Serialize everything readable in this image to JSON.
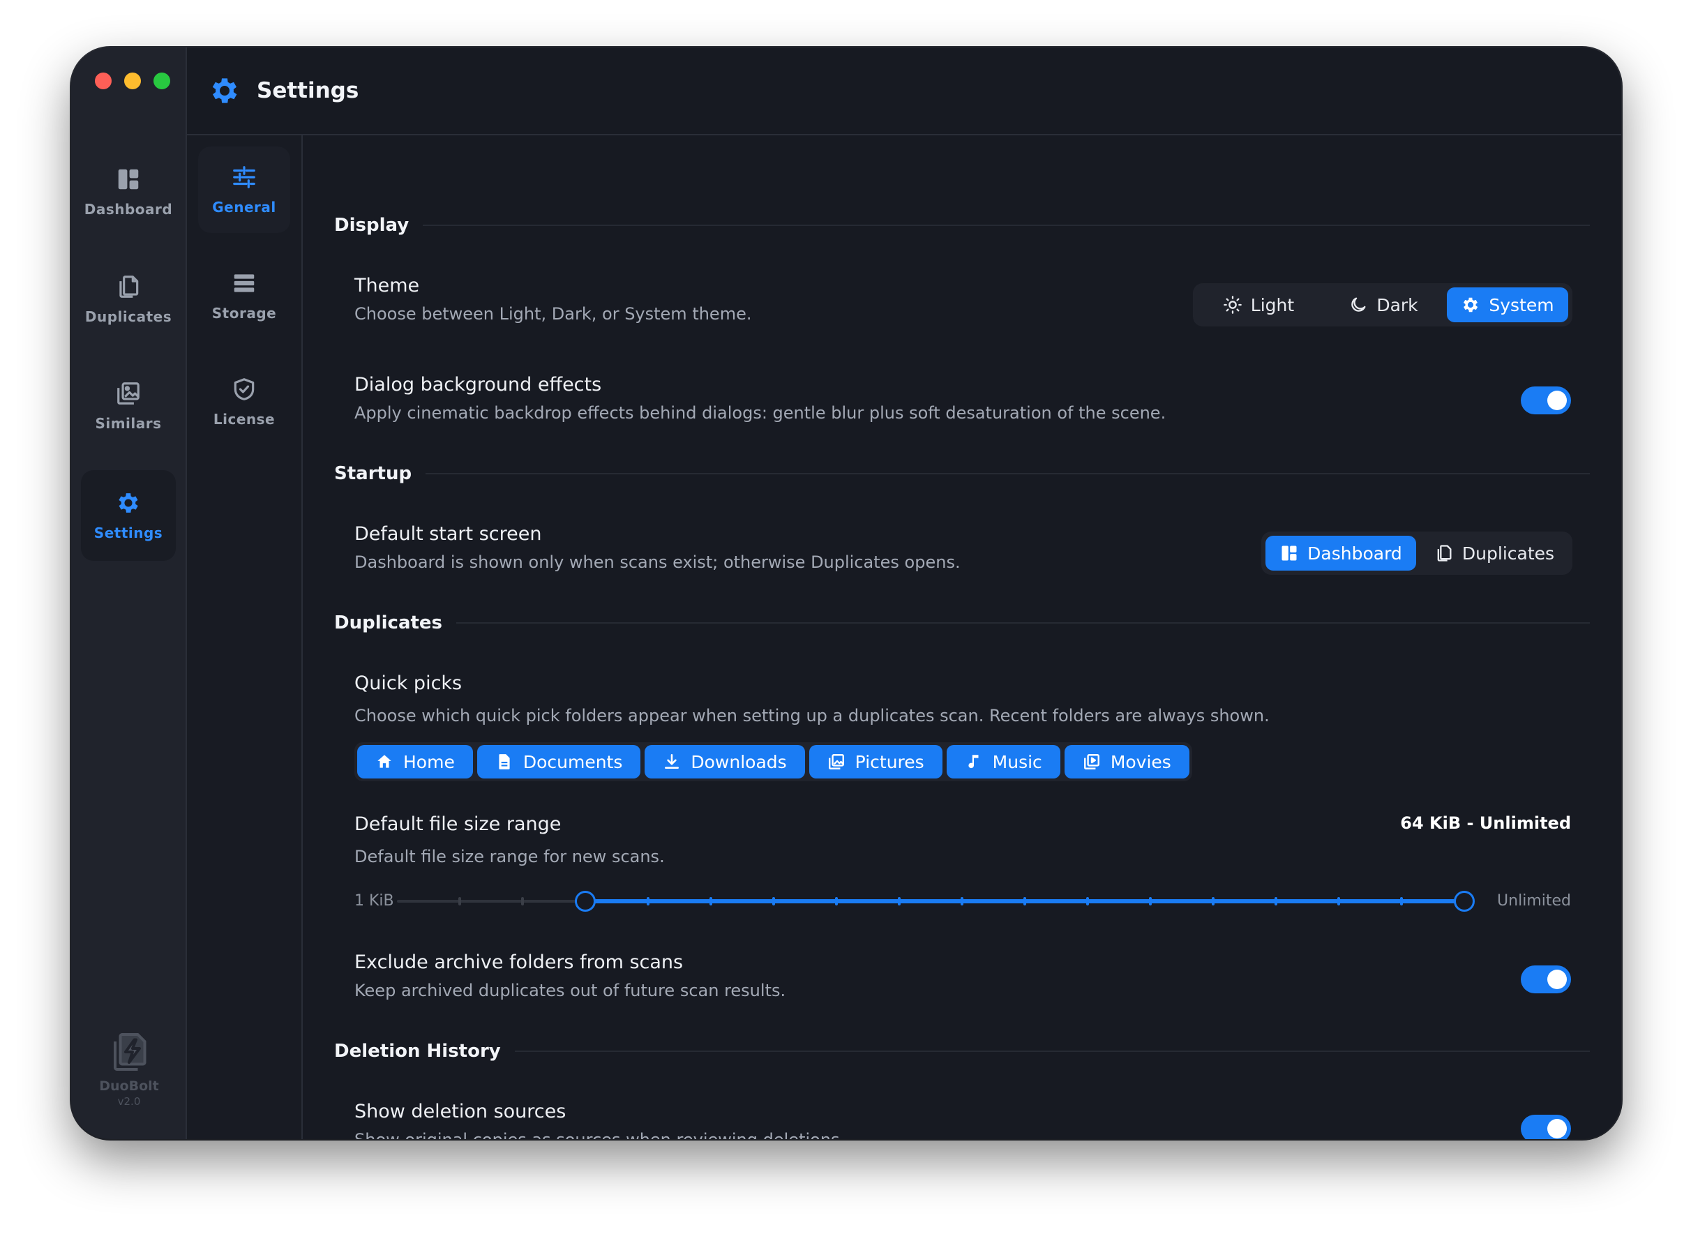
{
  "window": {
    "title": "Settings"
  },
  "main_nav": {
    "items": [
      {
        "label": "Dashboard",
        "icon": "dashboard-icon",
        "active": false
      },
      {
        "label": "Duplicates",
        "icon": "duplicates-icon",
        "active": false
      },
      {
        "label": "Similars",
        "icon": "similars-icon",
        "active": false
      },
      {
        "label": "Settings",
        "icon": "gear-icon",
        "active": true
      }
    ],
    "brand": {
      "name": "DuoBolt",
      "version": "v2.0"
    }
  },
  "sub_nav": {
    "items": [
      {
        "label": "General",
        "icon": "sliders-icon",
        "active": true
      },
      {
        "label": "Storage",
        "icon": "storage-icon",
        "active": false
      },
      {
        "label": "License",
        "icon": "shield-check-icon",
        "active": false
      }
    ]
  },
  "sections": {
    "display": {
      "label": "Display",
      "theme": {
        "title": "Theme",
        "description": "Choose between Light, Dark, or System theme.",
        "options": [
          "Light",
          "Dark",
          "System"
        ],
        "selected": "System"
      },
      "dialog_effects": {
        "title": "Dialog background effects",
        "description": "Apply cinematic backdrop effects behind dialogs: gentle blur plus soft desaturation of the scene.",
        "enabled": true
      }
    },
    "startup": {
      "label": "Startup",
      "default_screen": {
        "title": "Default start screen",
        "description": "Dashboard is shown only when scans exist; otherwise Duplicates opens.",
        "options": [
          "Dashboard",
          "Duplicates"
        ],
        "selected": "Dashboard"
      }
    },
    "duplicates": {
      "label": "Duplicates",
      "quick_picks": {
        "title": "Quick picks",
        "description": "Choose which quick pick folders appear when setting up a duplicates scan. Recent folders are always shown.",
        "folders": [
          "Home",
          "Documents",
          "Downloads",
          "Pictures",
          "Music",
          "Movies"
        ]
      },
      "size_range": {
        "title": "Default file size range",
        "description": "Default file size range for new scans.",
        "value_text": "64 KiB - Unlimited",
        "min_label": "1 KiB",
        "max_label": "Unlimited",
        "steps": 15,
        "low_index": 3,
        "high_index": 17
      },
      "exclude_archive": {
        "title": "Exclude archive folders from scans",
        "description": "Keep archived duplicates out of future scan results.",
        "enabled": true
      }
    },
    "deletion_history": {
      "label": "Deletion History",
      "show_sources": {
        "title": "Show deletion sources",
        "description": "Show original copies as sources when reviewing deletions.",
        "enabled": true
      }
    }
  },
  "colors": {
    "accent": "#1a7cf4",
    "background": "#171a22",
    "sidebar": "#20232c"
  }
}
